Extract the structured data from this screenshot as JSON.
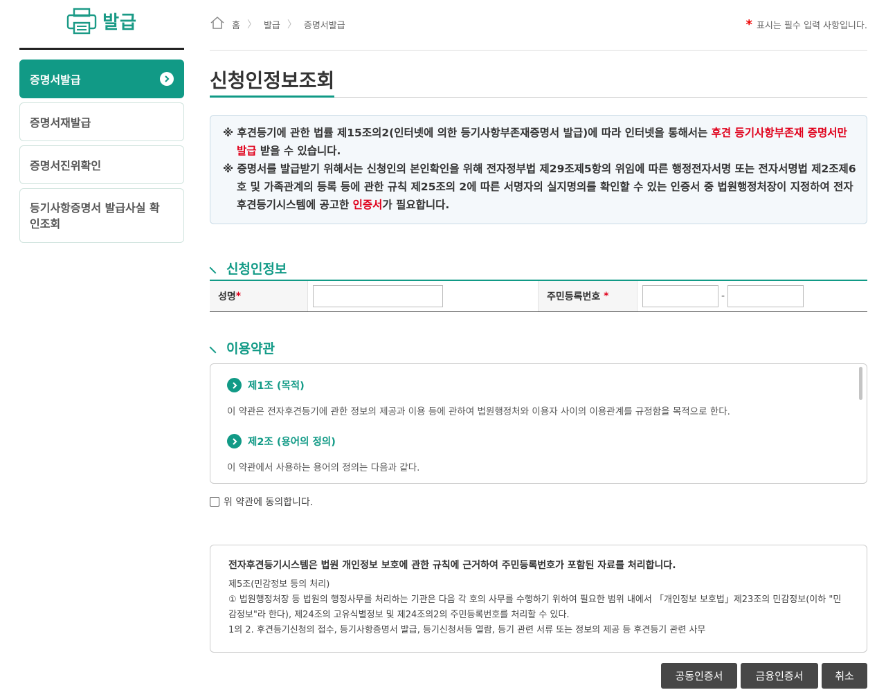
{
  "sidebar": {
    "title": "발급",
    "items": [
      {
        "label": "증명서발급"
      },
      {
        "label": "증명서재발급"
      },
      {
        "label": "증명서진위확인"
      },
      {
        "label": "등기사항증명서 발급사실 확인조회"
      }
    ]
  },
  "breadcrumb": {
    "home": "홈",
    "level1": "발급",
    "level2": "증명서발급"
  },
  "required_note": {
    "star": "*",
    "text": "표시는 필수 입력 사항입니다."
  },
  "page_title": "신청인정보조회",
  "notice": {
    "line1_mark": "※",
    "line1_text": "후견등기에 관한 법률 제15조의2(인터넷에 의한 등기사항부존재증명서 발급)에 따라 인터넷을 통해서는 ",
    "line1_red": "후견 등기사항부존재 증명서만 발급",
    "line1_tail": " 받을 수 있습니다.",
    "line2_mark": "※",
    "line2_text": "증명서를 발급받기 위해서는 신청인의 본인확인을 위해 전자정부법 제29조제5항의 위임에 따른 행정전자서명 또는 전자서명법 제2조제6호 및 가족관계의 등록 등에 관한 규칙 제25조의 2에 따른 서명자의 실지명의를 확인할 수 있는 인증서 중 법원행정처장이 지정하여 전자후견등기시스템에 공고한 ",
    "line2_red": "인증서",
    "line2_tail": "가 필요합니다."
  },
  "applicant": {
    "section_title": "신청인정보",
    "name_label": "성명",
    "name_star": "*",
    "rrn_label": "주민등록번호",
    "rrn_star": "*",
    "name_value": "",
    "rrn_front": "",
    "rrn_back": "",
    "dash": "-"
  },
  "terms": {
    "section_title": "이용약관",
    "articles": [
      {
        "head": "제1조 (목적)",
        "body": "이 약관은 전자후견등기에 관한 정보의 제공과 이용 등에 관하여 법원행정처와 이용자 사이의 이용관계를 규정함을 목적으로 한다."
      },
      {
        "head": "제2조 (용어의 정의)",
        "body": "이 약관에서 사용하는 용어의 정의는 다음과 같다."
      }
    ],
    "agree_label": "위 약관에 동의합니다."
  },
  "privacy": {
    "heading": "전자후견등기시스템은 법원 개인정보 보호에 관한 규칙에 근거하여 주민등록번호가 포함된 자료를 처리합니다.",
    "lines": [
      "제5조(민감정보 등의 처리)",
      "① 법원행정처장 등 법원의 행정사무를 처리하는 기관은 다음 각 호의 사무를 수행하기 위하여 필요한 범위 내에서 「개인정보 보호법」제23조의 민감정보(이하 \"민감정보\"라 한다), 제24조의 고유식별정보 및 제24조의2의 주민등록번호를 처리할 수 있다.",
      "1의 2. 후견등기신청의 접수, 등기사항증명서 발급, 등기신청서등 열람, 등기 관련 서류 또는 정보의 제공 등 후견등기 관련 사무"
    ]
  },
  "buttons": {
    "joint_cert": "공동인증서",
    "financial_cert": "금융인증서",
    "cancel": "취소"
  },
  "colors": {
    "accent": "#119a86",
    "red": "#e0001b",
    "button": "#474747"
  }
}
